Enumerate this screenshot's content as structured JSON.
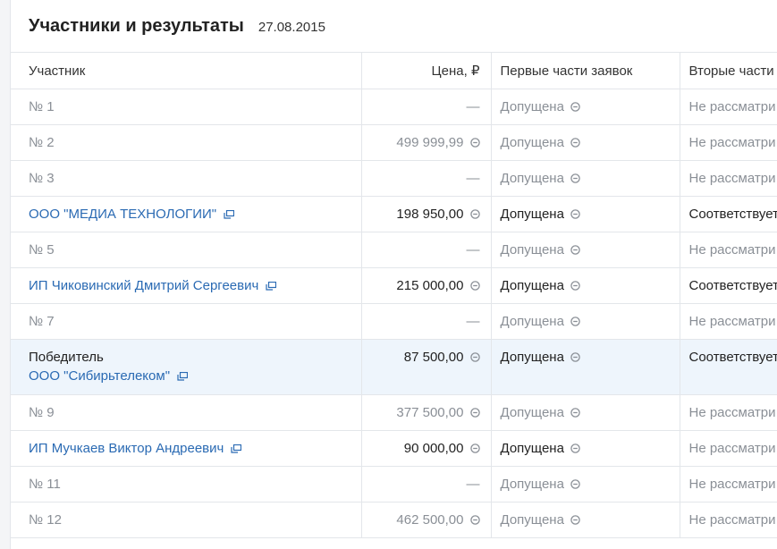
{
  "header": {
    "title": "Участники и результаты",
    "date": "27.08.2015"
  },
  "columns": {
    "participant": "Участник",
    "price": "Цена,  ₽",
    "first_parts": "Первые части заявок",
    "second_parts": "Вторые части"
  },
  "rows": [
    {
      "participant": "№ 1",
      "type": "anon",
      "price": "—",
      "first": "Допущена",
      "second": "Не рассматри"
    },
    {
      "participant": "№ 2",
      "type": "anon",
      "price": "499 999,99",
      "first": "Допущена",
      "second": "Не рассматри"
    },
    {
      "participant": "№ 3",
      "type": "anon",
      "price": "—",
      "first": "Допущена",
      "second": "Не рассматри"
    },
    {
      "participant": "ООО \"МЕДИА ТЕХНОЛОГИИ\"",
      "type": "link",
      "price": "198 950,00",
      "first": "Допущена",
      "second": "Соответствует"
    },
    {
      "participant": "№ 5",
      "type": "anon",
      "price": "—",
      "first": "Допущена",
      "second": "Не рассматри"
    },
    {
      "participant": "ИП Чиковинский Дмитрий Сергеевич",
      "type": "link",
      "price": "215 000,00",
      "first": "Допущена",
      "second": "Соответствует"
    },
    {
      "participant": "№ 7",
      "type": "anon",
      "price": "—",
      "first": "Допущена",
      "second": "Не рассматри"
    },
    {
      "participant": "ООО \"Сибирьтелеком\"",
      "type": "winner",
      "winner_label": "Победитель",
      "price": "87 500,00",
      "first": "Допущена",
      "second": "Соответствует"
    },
    {
      "participant": "№ 9",
      "type": "anon",
      "price": "377 500,00",
      "first": "Допущена",
      "second": "Не рассматри"
    },
    {
      "participant": "ИП Мучкаев Виктор Андреевич",
      "type": "link",
      "price": "90 000,00",
      "first": "Допущена",
      "second": "Не рассматри"
    },
    {
      "participant": "№ 11",
      "type": "anon",
      "price": "—",
      "first": "Допущена",
      "second": "Не рассматри"
    },
    {
      "participant": "№ 12",
      "type": "anon",
      "price": "462 500,00",
      "first": "Допущена",
      "second": "Не рассматри"
    }
  ],
  "colors": {
    "link": "#2a6ab3",
    "muted": "#8a8f96",
    "winner_bg": "#eef5fc",
    "border": "#e3e6ea"
  },
  "icons": {
    "external": "open-in-new-window-icon",
    "status": "clock-icon"
  }
}
